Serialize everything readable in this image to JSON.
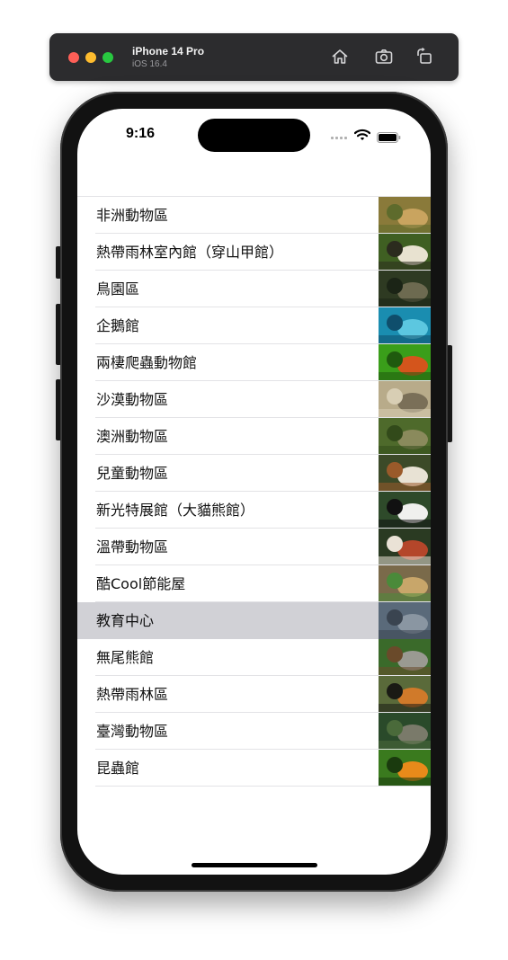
{
  "simulator": {
    "device_name": "iPhone 14 Pro",
    "os_version": "iOS 16.4"
  },
  "status_bar": {
    "time": "9:16"
  },
  "list": {
    "selected_index": 11,
    "items": [
      {
        "label": "非洲動物區",
        "thumb": "lions",
        "colors": [
          "#8a7a3a",
          "#c9a45f",
          "#5e6b2c"
        ]
      },
      {
        "label": "熱帶雨林室內館（穿山甲館）",
        "thumb": "monkeys",
        "colors": [
          "#3f5f22",
          "#e8e2d0",
          "#2b2b1e"
        ]
      },
      {
        "label": "鳥園區",
        "thumb": "birds",
        "colors": [
          "#2e3a22",
          "#6d6a50",
          "#1b2416"
        ]
      },
      {
        "label": "企鵝館",
        "thumb": "penguin",
        "colors": [
          "#1a8db0",
          "#5cc7e0",
          "#0f4e6c"
        ]
      },
      {
        "label": "兩棲爬蟲動物館",
        "thumb": "frog",
        "colors": [
          "#3a9e1a",
          "#d4551c",
          "#1f5a0e"
        ]
      },
      {
        "label": "沙漠動物區",
        "thumb": "camel",
        "colors": [
          "#b8ab8a",
          "#7a6f58",
          "#d8ceb4"
        ]
      },
      {
        "label": "澳洲動物區",
        "thumb": "kangaroo",
        "colors": [
          "#4e6a2b",
          "#8a8a5c",
          "#324a1a"
        ]
      },
      {
        "label": "兒童動物區",
        "thumb": "alpaca",
        "colors": [
          "#3c4a28",
          "#e8e2d4",
          "#9a5a2a"
        ]
      },
      {
        "label": "新光特展館（大貓熊館）",
        "thumb": "panda",
        "colors": [
          "#2e4a2a",
          "#f0f0ee",
          "#111111"
        ]
      },
      {
        "label": "溫帶動物區",
        "thumb": "redpanda",
        "colors": [
          "#2a3a22",
          "#b4462a",
          "#eae2d6"
        ]
      },
      {
        "label": "酷Cool節能屋",
        "thumb": "house",
        "colors": [
          "#7a6a4a",
          "#c8a66a",
          "#4a8a3a"
        ]
      },
      {
        "label": "教育中心",
        "thumb": "elephant",
        "colors": [
          "#5a6a7a",
          "#8a96a2",
          "#3a4450"
        ]
      },
      {
        "label": "無尾熊館",
        "thumb": "koala",
        "colors": [
          "#3a6a2a",
          "#9a9a92",
          "#6a4a2a"
        ]
      },
      {
        "label": "熱帶雨林區",
        "thumb": "tiger",
        "colors": [
          "#5a6a3a",
          "#d07a2a",
          "#1a1a14"
        ]
      },
      {
        "label": "臺灣動物區",
        "thumb": "macaque",
        "colors": [
          "#2a4a2a",
          "#7a7a6a",
          "#4a6a3a"
        ]
      },
      {
        "label": "昆蟲館",
        "thumb": "butterfly",
        "colors": [
          "#3a7a1e",
          "#e88a1a",
          "#1a3a0e"
        ]
      }
    ]
  }
}
